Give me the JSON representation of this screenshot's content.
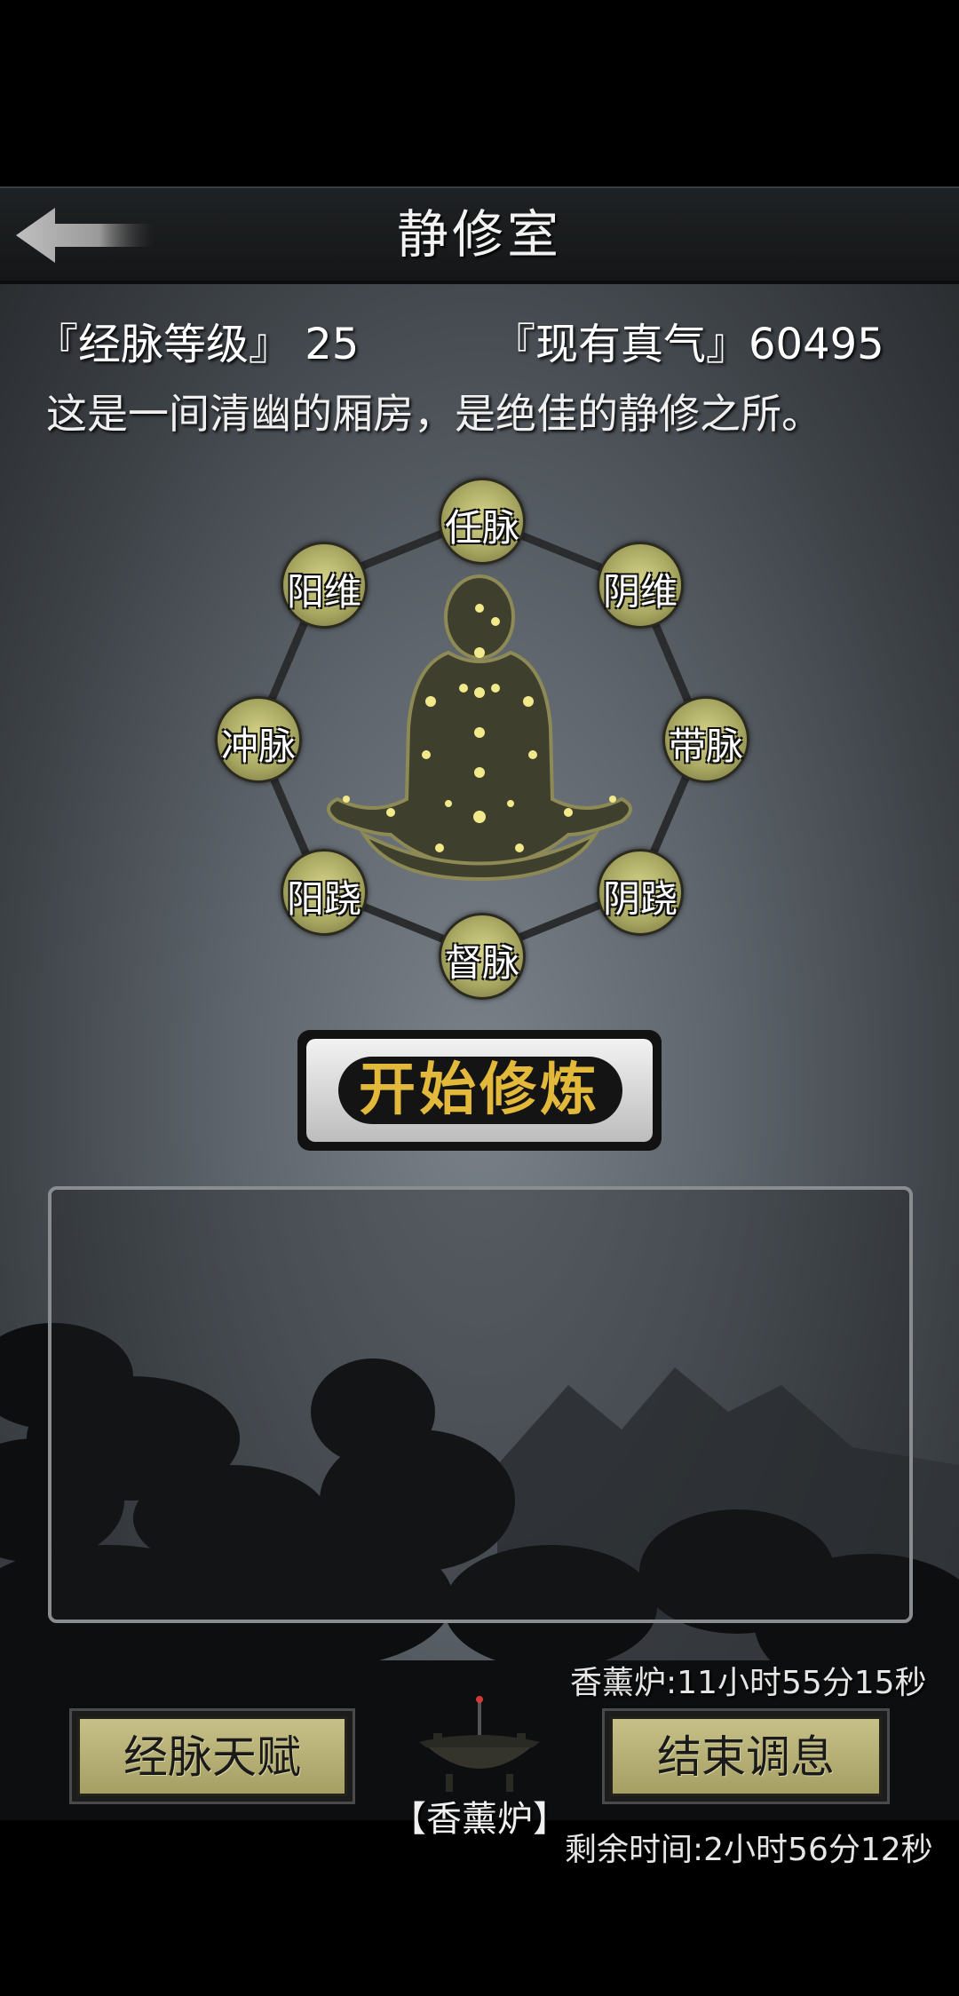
{
  "header": {
    "title": "静修室",
    "back_icon": "back-arrow-icon"
  },
  "stats": {
    "meridian_level": "『经脉等级』 25",
    "true_qi": "『现有真气』60495"
  },
  "description": "这是一间清幽的厢房，是绝佳的静修之所。",
  "meridians": [
    {
      "id": "ren",
      "label": "任脉"
    },
    {
      "id": "yinwei",
      "label": "阴维"
    },
    {
      "id": "dai",
      "label": "带脉"
    },
    {
      "id": "yinqiao",
      "label": "阴跷"
    },
    {
      "id": "du",
      "label": "督脉"
    },
    {
      "id": "yangqiao",
      "label": "阳跷"
    },
    {
      "id": "chong",
      "label": "冲脉"
    },
    {
      "id": "yangwei",
      "label": "阳维"
    }
  ],
  "start_button": {
    "label": "开始修炼"
  },
  "timers": {
    "incense": "香薰炉:11小时55分15秒",
    "remaining": "剩余时间:2小时56分12秒"
  },
  "buttons": {
    "talent": "经脉天赋",
    "end": "结束调息"
  },
  "incense_burner": {
    "label": "【香薰炉】",
    "icon": "incense-burner-icon"
  },
  "colors": {
    "accent_gold": "#e2b93a",
    "node_fill": "#c9c67e",
    "button_fill": "#b8b276"
  }
}
